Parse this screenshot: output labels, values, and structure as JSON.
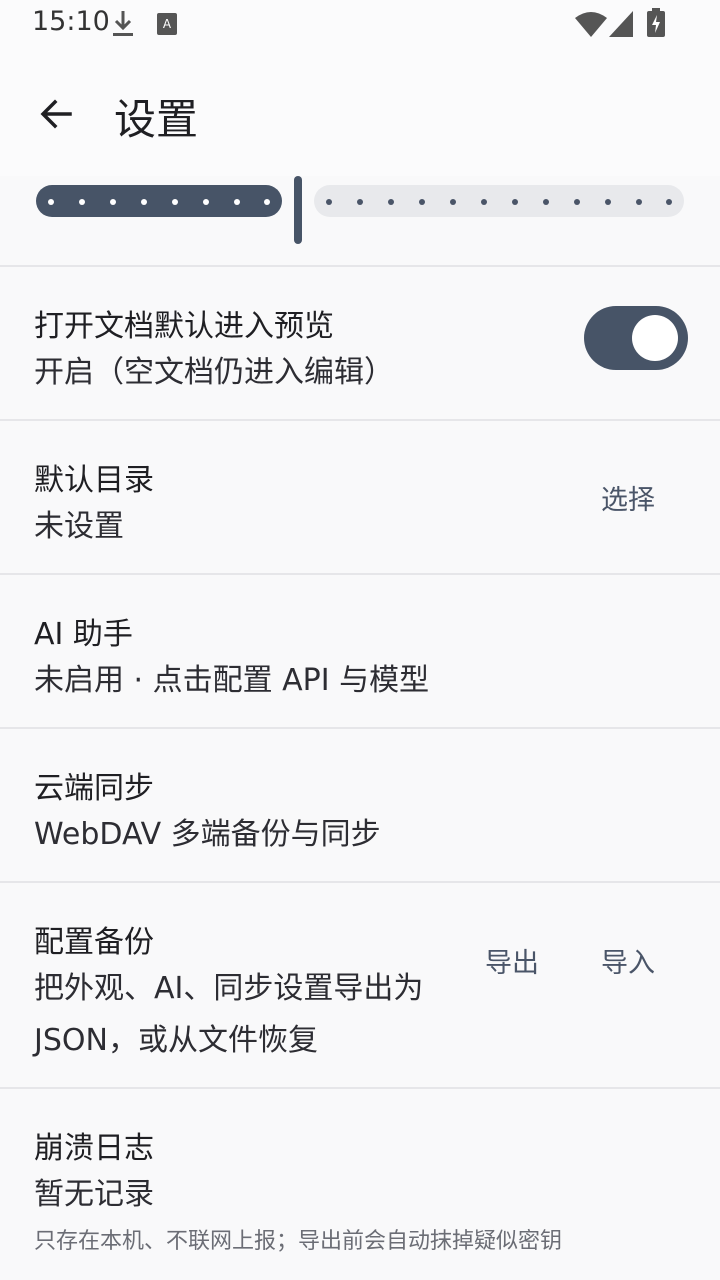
{
  "status_bar": {
    "time": "15:10",
    "icons": [
      "download-icon",
      "keyboard-a-icon",
      "wifi-icon",
      "signal-icon",
      "battery-charging-icon"
    ]
  },
  "app_bar": {
    "back_icon": "arrow-left-icon",
    "title": "设置"
  },
  "slider": {
    "value_fraction": 0.42
  },
  "settings": {
    "preview": {
      "title": "打开文档默认进入预览",
      "subtitle": "开启（空文档仍进入编辑）",
      "enabled": true
    },
    "default_dir": {
      "title": "默认目录",
      "subtitle": "未设置",
      "action": "选择"
    },
    "ai": {
      "title": "AI 助手",
      "subtitle": "未启用 · 点击配置 API 与模型"
    },
    "sync": {
      "title": "云端同步",
      "subtitle": "WebDAV 多端备份与同步"
    },
    "backup": {
      "title": "配置备份",
      "subtitle": "把外观、AI、同步设置导出为 JSON，或从文件恢复",
      "export_label": "导出",
      "import_label": "导入"
    },
    "crash": {
      "title": "崩溃日志",
      "subtitle": "暂无记录",
      "note": "只存在本机、不联网上报；导出前会自动抹掉疑似密钥"
    }
  },
  "colors": {
    "accent": "#475467",
    "background": "#f9f9fa",
    "divider": "#e6e6e9"
  }
}
